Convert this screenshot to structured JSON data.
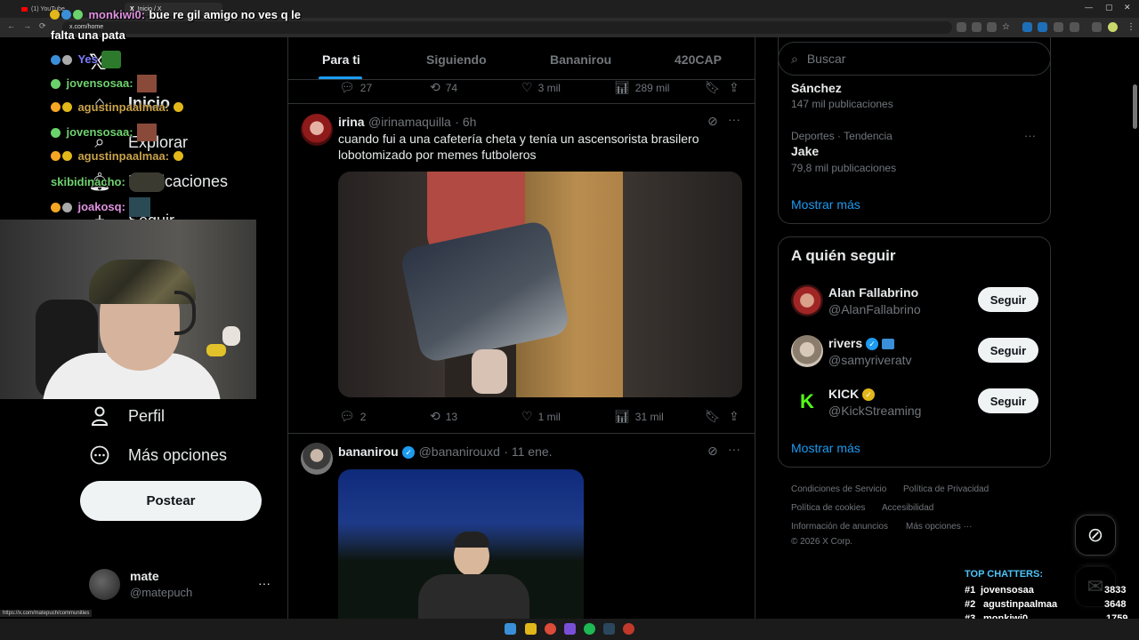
{
  "browser": {
    "tabs": [
      "(1) YouTube",
      "Inicio / X"
    ],
    "url": "x.com/home",
    "status_url": "https://x.com/matepuch/communities"
  },
  "nav": {
    "items": [
      {
        "label": "Inicio",
        "icon": "home-icon"
      },
      {
        "label": "Explorar",
        "icon": "search-icon"
      },
      {
        "label": "Notificaciones",
        "icon": "bell-icon"
      },
      {
        "label": "Seguir",
        "icon": "follow-icon"
      },
      {
        "label": "Perfil",
        "icon": "person-icon"
      },
      {
        "label": "Más opciones",
        "icon": "more-circle-icon"
      }
    ],
    "post_label": "Postear",
    "account": {
      "name": "mate",
      "handle": "@matepuch"
    }
  },
  "feed": {
    "tabs": [
      "Para ti",
      "Siguiendo",
      "Bananirou",
      "420CAP"
    ],
    "prev_actions": {
      "replies": "27",
      "reposts": "74",
      "likes": "3 mil",
      "views": "289 mil"
    },
    "tweets": [
      {
        "name": "irina",
        "handle": "@irinamaquilla",
        "time": "· 6h",
        "text": "cuando fui a una cafetería cheta y tenía un ascensorista brasilero lobotomizado por memes futboleros",
        "actions": {
          "replies": "2",
          "reposts": "13",
          "likes": "1 mil",
          "views": "31 mil"
        }
      },
      {
        "name": "bananirou",
        "handle": "@bananirouxd",
        "time": "· 11 ene."
      }
    ]
  },
  "right": {
    "search_placeholder": "Buscar",
    "trends": [
      {
        "category": "",
        "name": "Sánchez",
        "count": "147 mil publicaciones"
      },
      {
        "category": "Deportes · Tendencia",
        "name": "Jake",
        "count": "79,8 mil publicaciones"
      }
    ],
    "show_more": "Mostrar más",
    "who_to_follow": {
      "title": "A quién seguir",
      "accounts": [
        {
          "name": "Alan Fallabrino",
          "handle": "@AlanFallabrino",
          "verified": ""
        },
        {
          "name": "rivers",
          "handle": "@samyriveratv",
          "verified": "blue"
        },
        {
          "name": "KICK",
          "handle": "@KickStreaming",
          "verified": "gold"
        }
      ],
      "follow_label": "Seguir",
      "show_more": "Mostrar más"
    },
    "footer": [
      "Condiciones de Servicio",
      "Política de Privacidad",
      "Política de cookies",
      "Accesibilidad",
      "Información de anuncios",
      "Más opciones ···",
      "© 2026 X Corp."
    ]
  },
  "overlay": {
    "chat": [
      {
        "user": "monkiwi0:",
        "msg": "bue re gil amigo no ves q le"
      },
      {
        "user": "",
        "msg": "falta una pata"
      },
      {
        "user": "Yes",
        "msg": ""
      },
      {
        "user": "jovensosaa:",
        "msg": ""
      },
      {
        "user": "agustinpaalmaa:",
        "msg": ""
      },
      {
        "user": "jovensosaa:",
        "msg": ""
      },
      {
        "user": "agustinpaalmaa:",
        "msg": ""
      },
      {
        "user": "skibidinacho:",
        "msg": ""
      },
      {
        "user": "joakosq:",
        "msg": ""
      }
    ],
    "top_chatters": {
      "title": "TOP CHATTERS:",
      "list": [
        {
          "rank": "#1",
          "name": "jovensosaa",
          "count": "3833"
        },
        {
          "rank": "#2",
          "name": "agustinpaalmaa",
          "count": "3648"
        },
        {
          "rank": "#3",
          "name": "monkiwi0",
          "count": "1759"
        }
      ]
    }
  },
  "colors": {
    "accent": "#1d9bf0",
    "border": "#2f3336",
    "muted": "#71767b"
  }
}
